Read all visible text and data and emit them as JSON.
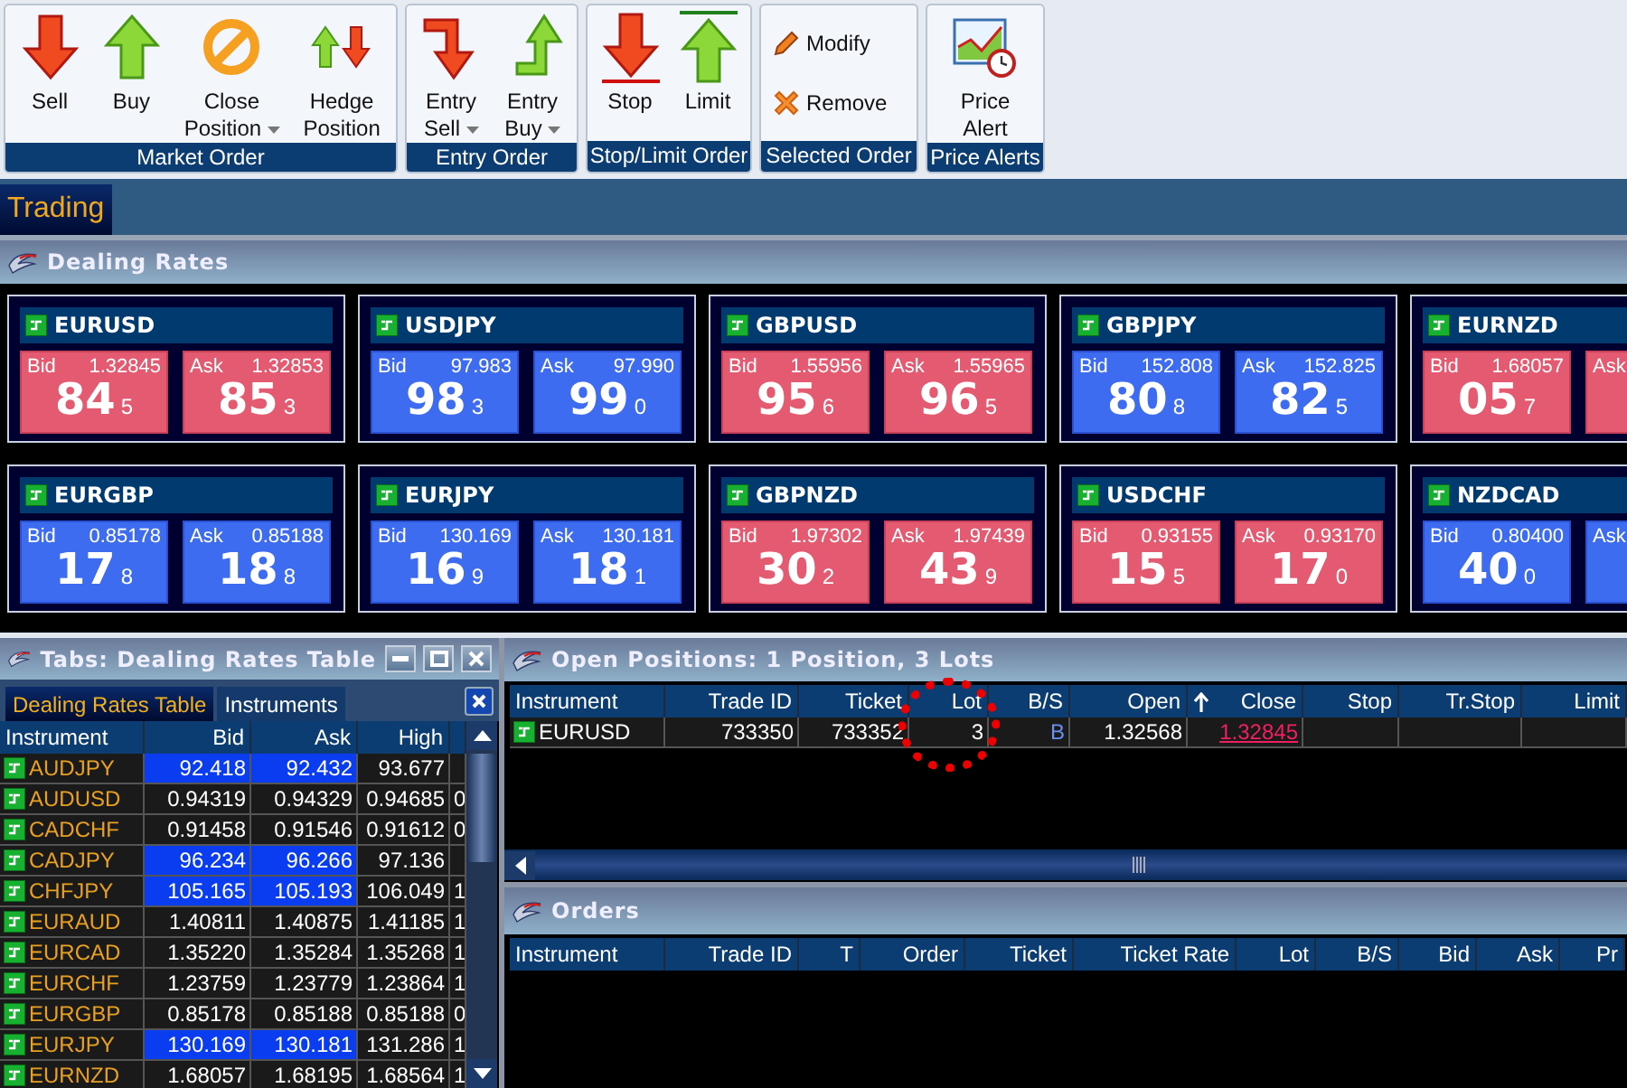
{
  "toolbar": {
    "groups": [
      {
        "label": "Market Order",
        "compact": false,
        "buttons": [
          {
            "kind": "sell",
            "lines": [
              "Sell"
            ],
            "dropdown": false
          },
          {
            "kind": "buy",
            "lines": [
              "Buy"
            ],
            "dropdown": false
          },
          {
            "kind": "close",
            "lines": [
              "Close",
              "Position"
            ],
            "dropdown": true
          },
          {
            "kind": "hedge",
            "lines": [
              "Hedge",
              "Position"
            ],
            "dropdown": false
          }
        ]
      },
      {
        "label": "Entry Order",
        "compact": false,
        "buttons": [
          {
            "kind": "entry_sell",
            "lines": [
              "Entry",
              "Sell"
            ],
            "dropdown": true
          },
          {
            "kind": "entry_buy",
            "lines": [
              "Entry",
              "Buy"
            ],
            "dropdown": true
          }
        ]
      },
      {
        "label": "Stop/Limit Order",
        "compact": false,
        "buttons": [
          {
            "kind": "stop",
            "lines": [
              "Stop"
            ],
            "dropdown": false
          },
          {
            "kind": "limit",
            "lines": [
              "Limit"
            ],
            "dropdown": false
          }
        ]
      },
      {
        "label": "Selected Order",
        "compact": true,
        "buttons": [
          {
            "kind": "modify",
            "lines": [
              "Modify"
            ],
            "dropdown": false
          },
          {
            "kind": "remove",
            "lines": [
              "Remove"
            ],
            "dropdown": false
          }
        ]
      },
      {
        "label": "Price Alerts",
        "compact": false,
        "buttons": [
          {
            "kind": "alert",
            "lines": [
              "Price",
              "Alert"
            ],
            "dropdown": false
          }
        ]
      }
    ]
  },
  "tabs": [
    {
      "label": "Trading",
      "selected": true
    }
  ],
  "dealing_rates": {
    "title": "Dealing Rates",
    "tiles": [
      {
        "pair": "EURUSD",
        "bid": {
          "label": "Bid",
          "price": "1.32845",
          "big": "84",
          "pip": "5",
          "rising": false
        },
        "ask": {
          "label": "Ask",
          "price": "1.32853",
          "big": "85",
          "pip": "3",
          "rising": false
        }
      },
      {
        "pair": "USDJPY",
        "bid": {
          "label": "Bid",
          "price": "97.983",
          "big": "98",
          "pip": "3",
          "rising": true
        },
        "ask": {
          "label": "Ask",
          "price": "97.990",
          "big": "99",
          "pip": "0",
          "rising": true
        }
      },
      {
        "pair": "GBPUSD",
        "bid": {
          "label": "Bid",
          "price": "1.55956",
          "big": "95",
          "pip": "6",
          "rising": false
        },
        "ask": {
          "label": "Ask",
          "price": "1.55965",
          "big": "96",
          "pip": "5",
          "rising": false
        }
      },
      {
        "pair": "GBPJPY",
        "bid": {
          "label": "Bid",
          "price": "152.808",
          "big": "80",
          "pip": "8",
          "rising": true
        },
        "ask": {
          "label": "Ask",
          "price": "152.825",
          "big": "82",
          "pip": "5",
          "rising": true
        }
      },
      {
        "pair": "EURNZD",
        "bid": {
          "label": "Bid",
          "price": "1.68057",
          "big": "05",
          "pip": "7",
          "rising": false
        },
        "ask": {
          "label": "Ask",
          "rising": false
        }
      },
      {
        "pair": "EURGBP",
        "bid": {
          "label": "Bid",
          "price": "0.85178",
          "big": "17",
          "pip": "8",
          "rising": true
        },
        "ask": {
          "label": "Ask",
          "price": "0.85188",
          "big": "18",
          "pip": "8",
          "rising": true
        }
      },
      {
        "pair": "EURJPY",
        "bid": {
          "label": "Bid",
          "price": "130.169",
          "big": "16",
          "pip": "9",
          "rising": true
        },
        "ask": {
          "label": "Ask",
          "price": "130.181",
          "big": "18",
          "pip": "1",
          "rising": true
        }
      },
      {
        "pair": "GBPNZD",
        "bid": {
          "label": "Bid",
          "price": "1.97302",
          "big": "30",
          "pip": "2",
          "rising": false
        },
        "ask": {
          "label": "Ask",
          "price": "1.97439",
          "big": "43",
          "pip": "9",
          "rising": false
        }
      },
      {
        "pair": "USDCHF",
        "bid": {
          "label": "Bid",
          "price": "0.93155",
          "big": "15",
          "pip": "5",
          "rising": false
        },
        "ask": {
          "label": "Ask",
          "price": "0.93170",
          "big": "17",
          "pip": "0",
          "rising": false
        }
      },
      {
        "pair": "NZDCAD",
        "bid": {
          "label": "Bid",
          "price": "0.80400",
          "big": "40",
          "pip": "0",
          "rising": true
        },
        "ask": {
          "label": "Ask",
          "rising": true
        }
      }
    ]
  },
  "rates_table": {
    "title": "Tabs: Dealing Rates Table",
    "tabs": [
      {
        "label": "Dealing Rates Table",
        "selected": true
      },
      {
        "label": "Instruments",
        "selected": false
      }
    ],
    "columns": [
      "Instrument",
      "Bid",
      "Ask",
      "High"
    ],
    "rows": [
      {
        "instrument": "AUDJPY",
        "bid": "92.418",
        "ask": "92.432",
        "high": "93.677",
        "highlighted": true
      },
      {
        "instrument": "AUDUSD",
        "bid": "0.94319",
        "ask": "0.94329",
        "high": "0.94685",
        "column_5": "0",
        "highlighted": false
      },
      {
        "instrument": "CADCHF",
        "bid": "0.91458",
        "ask": "0.91546",
        "high": "0.91612",
        "column_5": "0",
        "highlighted": false
      },
      {
        "instrument": "CADJPY",
        "bid": "96.234",
        "ask": "96.266",
        "high": "97.136",
        "highlighted": true
      },
      {
        "instrument": "CHFJPY",
        "bid": "105.165",
        "ask": "105.193",
        "high": "106.049",
        "column_5": "1",
        "highlighted": true
      },
      {
        "instrument": "EURAUD",
        "bid": "1.40811",
        "ask": "1.40875",
        "high": "1.41185",
        "column_5": "1",
        "highlighted": false
      },
      {
        "instrument": "EURCAD",
        "bid": "1.35220",
        "ask": "1.35284",
        "high": "1.35268",
        "column_5": "1",
        "highlighted": false
      },
      {
        "instrument": "EURCHF",
        "bid": "1.23759",
        "ask": "1.23779",
        "high": "1.23864",
        "column_5": "1",
        "highlighted": false
      },
      {
        "instrument": "EURGBP",
        "bid": "0.85178",
        "ask": "0.85188",
        "high": "0.85188",
        "column_5": "0",
        "highlighted": false
      },
      {
        "instrument": "EURJPY",
        "bid": "130.169",
        "ask": "130.181",
        "high": "131.286",
        "column_5": "1",
        "highlighted": true
      },
      {
        "instrument": "EURNZD",
        "bid": "1.68057",
        "ask": "1.68195",
        "high": "1.68564",
        "column_5": "1",
        "highlighted": false
      }
    ]
  },
  "open_positions": {
    "title": "Open Positions: 1 Position, 3 Lots",
    "columns": [
      {
        "label": "Instrument",
        "sorted": false,
        "circled": false
      },
      {
        "label": "Trade ID",
        "sorted": false,
        "circled": false
      },
      {
        "label": "Ticket",
        "sorted": false,
        "circled": false
      },
      {
        "label": "Lot",
        "sorted": false,
        "circled": true
      },
      {
        "label": "B/S",
        "sorted": false,
        "circled": false
      },
      {
        "label": "Open",
        "sorted": false,
        "circled": false
      },
      {
        "label": "Close",
        "sorted": true,
        "circled": false
      },
      {
        "label": "Stop",
        "sorted": false,
        "circled": false
      },
      {
        "label": "Tr.Stop",
        "sorted": false,
        "circled": false
      },
      {
        "label": "Limit",
        "sorted": false,
        "circled": false
      }
    ],
    "rows": [
      {
        "cells": [
          "EURUSD",
          "733350",
          "733352",
          "3",
          "B",
          "1.32568",
          "1.32845",
          "",
          "",
          ""
        ],
        "close_rising": false
      }
    ]
  },
  "orders": {
    "title": "Orders",
    "columns": [
      "Instrument",
      "Trade ID",
      "T",
      "Order",
      "Ticket",
      "Ticket Rate",
      "Lot",
      "B/S",
      "Bid",
      "Ask",
      "Pr"
    ]
  }
}
